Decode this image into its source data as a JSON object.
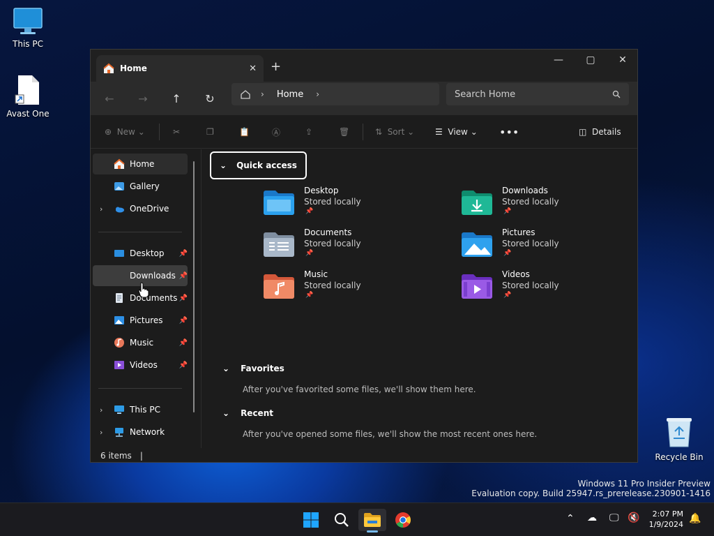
{
  "desktop": {
    "icons": [
      "This PC",
      "Avast One",
      "Recycle Bin"
    ],
    "watermark_line1": "Windows 11 Pro Insider Preview",
    "watermark_line2": "Evaluation copy. Build 25947.rs_prerelease.230901-1416"
  },
  "explorer": {
    "tab_title": "Home",
    "breadcrumb": "Home",
    "search_placeholder": "Search Home",
    "toolbar": {
      "new": "New",
      "sort": "Sort",
      "view": "View",
      "details": "Details"
    },
    "sidebar": {
      "top": [
        "Home",
        "Gallery",
        "OneDrive"
      ],
      "pinned": [
        "Desktop",
        "Downloads",
        "Documents",
        "Pictures",
        "Music",
        "Videos"
      ],
      "bottom": [
        "This PC",
        "Network"
      ]
    },
    "sections": {
      "quick_access": "Quick access",
      "favorites": "Favorites",
      "favorites_msg": "After you've favorited some files, we'll show them here.",
      "recent": "Recent",
      "recent_msg": "After you've opened some files, we'll show the most recent ones here."
    },
    "quick_items": [
      {
        "name": "Desktop",
        "sub": "Stored locally"
      },
      {
        "name": "Downloads",
        "sub": "Stored locally"
      },
      {
        "name": "Documents",
        "sub": "Stored locally"
      },
      {
        "name": "Pictures",
        "sub": "Stored locally"
      },
      {
        "name": "Music",
        "sub": "Stored locally"
      },
      {
        "name": "Videos",
        "sub": "Stored locally"
      }
    ],
    "status": "6 items"
  },
  "taskbar": {
    "time": "2:07 PM",
    "date": "1/9/2024"
  }
}
